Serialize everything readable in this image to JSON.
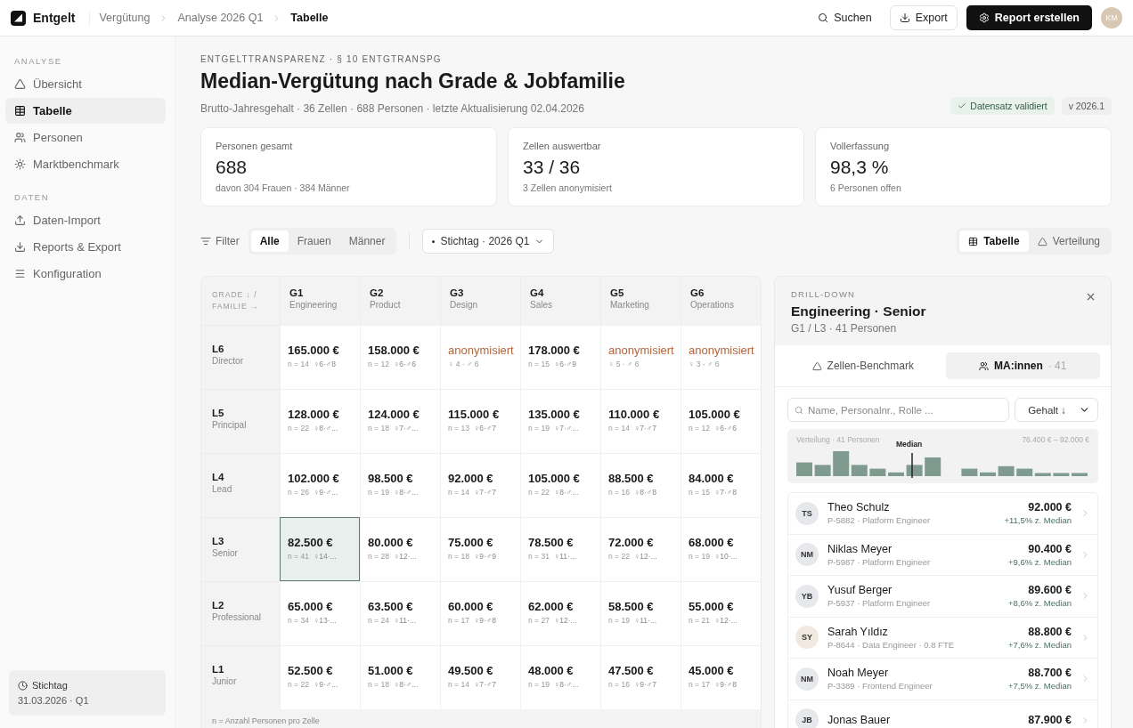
{
  "app": {
    "name": "Entgelt"
  },
  "breadcrumb": [
    {
      "label": "Vergütung",
      "current": false
    },
    {
      "label": "Analyse 2026 Q1",
      "current": false
    },
    {
      "label": "Tabelle",
      "current": true
    }
  ],
  "topbar": {
    "search": "Suchen",
    "export": "Export",
    "primary": "Report erstellen",
    "avatar": "KM"
  },
  "sidebar": {
    "sections": [
      {
        "title": "ANALYSE",
        "items": [
          {
            "label": "Übersicht",
            "selected": false
          },
          {
            "label": "Tabelle",
            "selected": true
          },
          {
            "label": "Personen",
            "selected": false
          },
          {
            "label": "Marktbenchmark",
            "selected": false
          }
        ]
      },
      {
        "title": "DATEN",
        "items": [
          {
            "label": "Daten-Import",
            "selected": false
          },
          {
            "label": "Reports & Export",
            "selected": false
          },
          {
            "label": "Konfiguration",
            "selected": false
          }
        ]
      }
    ],
    "footer": {
      "label": "Stichtag",
      "value": "31.03.2026 · Q1"
    }
  },
  "header": {
    "eyebrow": "ENTGELTTRANSPARENZ · § 10 ENTGTRANSPG",
    "title": "Median-Vergütung nach Grade & Jobfamilie",
    "subtitle": "Brutto-Jahresgehalt · 36 Zellen · 688 Personen · letzte Aktualisierung 02.04.2026",
    "badges": [
      {
        "label": "Datensatz validiert",
        "kind": "success"
      },
      {
        "label": "v 2026.1",
        "kind": "plain"
      }
    ]
  },
  "kpis": [
    {
      "label": "Personen gesamt",
      "value": "688",
      "note": "davon 304 Frauen · 384 Männer"
    },
    {
      "label": "Zellen auswertbar",
      "value": "33 / 36",
      "note": "3 Zellen anonymisiert"
    },
    {
      "label": "Vollerfassung",
      "value": "98,3 %",
      "note": "6 Personen offen"
    }
  ],
  "filter": {
    "label": "Filter",
    "segments": [
      {
        "label": "Alle",
        "selected": true
      },
      {
        "label": "Frauen",
        "selected": false
      },
      {
        "label": "Männer",
        "selected": false
      }
    ],
    "date": "Stichtag · 2026 Q1"
  },
  "views": [
    {
      "label": "Tabelle",
      "selected": true
    },
    {
      "label": "Verteilung",
      "selected": false
    }
  ],
  "table": {
    "corner": [
      "GRADE ↓ /",
      "FAMILIE →"
    ],
    "columns": [
      {
        "code": "G1",
        "name": "Engineering"
      },
      {
        "code": "G2",
        "name": "Product"
      },
      {
        "code": "G3",
        "name": "Design"
      },
      {
        "code": "G4",
        "name": "Sales"
      },
      {
        "code": "G5",
        "name": "Marketing"
      },
      {
        "code": "G6",
        "name": "Operations"
      }
    ],
    "rows": [
      {
        "code": "L6",
        "name": "Director",
        "cells": [
          {
            "kind": "value",
            "value": "165.000 €",
            "n": "n = 14",
            "split": "♀6·♂8",
            "selected": false
          },
          {
            "kind": "value",
            "value": "158.000 €",
            "n": "n = 12",
            "split": "♀6·♂6",
            "selected": false
          },
          {
            "kind": "anonymized",
            "value": "anonymisiert",
            "split": "♀ 4 · ♂ 6",
            "selected": false
          },
          {
            "kind": "value",
            "value": "178.000 €",
            "n": "n = 15",
            "split": "♀6·♂9",
            "selected": false
          },
          {
            "kind": "anonymized",
            "value": "anonymisiert",
            "split": "♀ 5 · ♂ 6",
            "selected": false
          },
          {
            "kind": "anonymized",
            "value": "anonymisiert",
            "split": "♀ 3 · ♂ 6",
            "selected": false
          }
        ]
      },
      {
        "code": "L5",
        "name": "Principal",
        "cells": [
          {
            "kind": "value",
            "value": "128.000 €",
            "n": "n = 22",
            "split": "♀8·♂...",
            "selected": false
          },
          {
            "kind": "value",
            "value": "124.000 €",
            "n": "n = 18",
            "split": "♀7·♂...",
            "selected": false
          },
          {
            "kind": "value",
            "value": "115.000 €",
            "n": "n = 13",
            "split": "♀6·♂7",
            "selected": false
          },
          {
            "kind": "value",
            "value": "135.000 €",
            "n": "n = 19",
            "split": "♀7·♂...",
            "selected": false
          },
          {
            "kind": "value",
            "value": "110.000 €",
            "n": "n = 14",
            "split": "♀7·♂7",
            "selected": false
          },
          {
            "kind": "value",
            "value": "105.000 €",
            "n": "n = 12",
            "split": "♀6·♂6",
            "selected": false
          }
        ]
      },
      {
        "code": "L4",
        "name": "Lead",
        "cells": [
          {
            "kind": "value",
            "value": "102.000 €",
            "n": "n = 26",
            "split": "♀9·♂...",
            "selected": false
          },
          {
            "kind": "value",
            "value": "98.500 €",
            "n": "n = 19",
            "split": "♀8·♂...",
            "selected": false
          },
          {
            "kind": "value",
            "value": "92.000 €",
            "n": "n = 14",
            "split": "♀7·♂7",
            "selected": false
          },
          {
            "kind": "value",
            "value": "105.000 €",
            "n": "n = 22",
            "split": "♀8·♂...",
            "selected": false
          },
          {
            "kind": "value",
            "value": "88.500 €",
            "n": "n = 16",
            "split": "♀8·♂8",
            "selected": false
          },
          {
            "kind": "value",
            "value": "84.000 €",
            "n": "n = 15",
            "split": "♀7·♂8",
            "selected": false
          }
        ]
      },
      {
        "code": "L3",
        "name": "Senior",
        "cells": [
          {
            "kind": "value",
            "value": "82.500 €",
            "n": "n = 41",
            "split": "♀14·...",
            "selected": true
          },
          {
            "kind": "value",
            "value": "80.000 €",
            "n": "n = 28",
            "split": "♀12·...",
            "selected": false
          },
          {
            "kind": "value",
            "value": "75.000 €",
            "n": "n = 18",
            "split": "♀9·♂9",
            "selected": false
          },
          {
            "kind": "value",
            "value": "78.500 €",
            "n": "n = 31",
            "split": "♀11·...",
            "selected": false
          },
          {
            "kind": "value",
            "value": "72.000 €",
            "n": "n = 22",
            "split": "♀12·...",
            "selected": false
          },
          {
            "kind": "value",
            "value": "68.000 €",
            "n": "n = 19",
            "split": "♀10·...",
            "selected": false
          }
        ]
      },
      {
        "code": "L2",
        "name": "Professional",
        "cells": [
          {
            "kind": "value",
            "value": "65.000 €",
            "n": "n = 34",
            "split": "♀13·...",
            "selected": false
          },
          {
            "kind": "value",
            "value": "63.500 €",
            "n": "n = 24",
            "split": "♀11·...",
            "selected": false
          },
          {
            "kind": "value",
            "value": "60.000 €",
            "n": "n = 17",
            "split": "♀9·♂8",
            "selected": false
          },
          {
            "kind": "value",
            "value": "62.000 €",
            "n": "n = 27",
            "split": "♀12·...",
            "selected": false
          },
          {
            "kind": "value",
            "value": "58.500 €",
            "n": "n = 19",
            "split": "♀11·...",
            "selected": false
          },
          {
            "kind": "value",
            "value": "55.000 €",
            "n": "n = 21",
            "split": "♀12·...",
            "selected": false
          }
        ]
      },
      {
        "code": "L1",
        "name": "Junior",
        "cells": [
          {
            "kind": "value",
            "value": "52.500 €",
            "n": "n = 22",
            "split": "♀9·♂...",
            "selected": false
          },
          {
            "kind": "value",
            "value": "51.000 €",
            "n": "n = 18",
            "split": "♀8·♂...",
            "selected": false
          },
          {
            "kind": "value",
            "value": "49.500 €",
            "n": "n = 14",
            "split": "♀7·♂7",
            "selected": false
          },
          {
            "kind": "value",
            "value": "48.000 €",
            "n": "n = 19",
            "split": "♀8·♂...",
            "selected": false
          },
          {
            "kind": "value",
            "value": "47.500 €",
            "n": "n = 16",
            "split": "♀9·♂7",
            "selected": false
          },
          {
            "kind": "value",
            "value": "45.000 €",
            "n": "n = 17",
            "split": "♀9·♂8",
            "selected": false
          }
        ]
      }
    ],
    "footnote": "n = Anzahl Personen pro Zelle"
  },
  "drilldown": {
    "eyebrow": "DRILL-DOWN",
    "title": "Engineering · Senior",
    "subtitle": "G1 / L3 · 41 Personen",
    "tabs": [
      {
        "label": "Zellen-Benchmark",
        "selected": false
      },
      {
        "label": "MA:innen",
        "count": "· 41",
        "selected": true
      }
    ],
    "search": {
      "placeholder": "Name, Personalnr., Rolle ..."
    },
    "sort": "Gehalt ↓",
    "histogram": {
      "label": "Verteilung · 41 Personen",
      "range": "76.400 € – 92.000 €",
      "marker": "Median"
    },
    "people": [
      {
        "initials": "TS",
        "color": "#e6e8eb",
        "name": "Theo Schulz",
        "meta": "P-5882 · Platform Engineer",
        "salary": "92.000 €",
        "delta": "+11,5% z. Median"
      },
      {
        "initials": "NM",
        "color": "#e6e8eb",
        "name": "Niklas Meyer",
        "meta": "P-5987 · Platform Engineer",
        "salary": "90.400 €",
        "delta": "+9,6% z. Median"
      },
      {
        "initials": "YB",
        "color": "#e6e8eb",
        "name": "Yusuf Berger",
        "meta": "P-5937 · Platform Engineer",
        "salary": "89.600 €",
        "delta": "+8,6% z. Median"
      },
      {
        "initials": "SY",
        "color": "#f1e9df",
        "name": "Sarah Yıldız",
        "meta": "P-8644 · Data Engineer · 0.8 FTE",
        "salary": "88.800 €",
        "delta": "+7,6% z. Median"
      },
      {
        "initials": "NM",
        "color": "#e6e8eb",
        "name": "Noah Meyer",
        "meta": "P-3389 · Frontend Engineer",
        "salary": "88.700 €",
        "delta": "+7,5% z. Median"
      },
      {
        "initials": "JB",
        "color": "#e6e8eb",
        "name": "Jonas Bauer",
        "salary": "87.900 €"
      }
    ]
  }
}
